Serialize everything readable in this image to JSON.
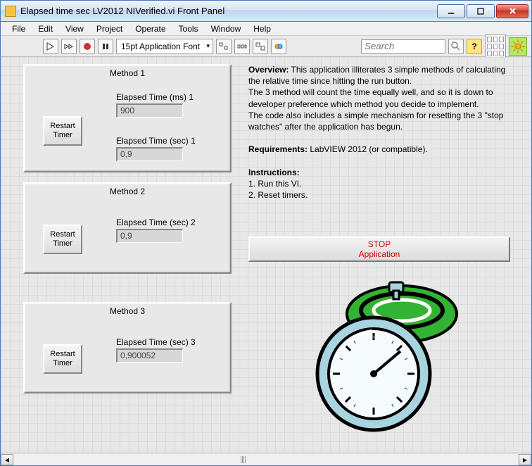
{
  "window": {
    "title": "Elapsed time sec LV2012 NIVerified.vi Front Panel"
  },
  "menu": {
    "file": "File",
    "edit": "Edit",
    "view": "View",
    "project": "Project",
    "operate": "Operate",
    "tools": "Tools",
    "window": "Window",
    "help": "Help"
  },
  "toolbar": {
    "font": "15pt Application Font",
    "search_placeholder": "Search",
    "help_label": "?"
  },
  "panels": {
    "p1": {
      "title": "Method 1",
      "restart": "Restart\nTimer",
      "label_ms": "Elapsed Time (ms) 1",
      "value_ms": "900",
      "label_sec": "Elapsed Time (sec) 1",
      "value_sec": "0,9"
    },
    "p2": {
      "title": "Method 2",
      "restart": "Restart\nTimer",
      "label": "Elapsed Time (sec) 2",
      "value": "0,9"
    },
    "p3": {
      "title": "Method 3",
      "restart": "Restart\nTimer",
      "label": "Elapsed Time (sec) 3",
      "value": "0,900052"
    }
  },
  "desc": {
    "overview_label": "Overview:",
    "overview_text": " This application illiterates 3 simple methods of calculating the relative time since hitting the run button.",
    "overview_text2": "The 3 method will count the time equally well, and so it is down to developer preference which method you decide to implement.",
    "overview_text3": "The code also includes a simple mechanism for resetting the 3 \"stop watches\" after the application has begun.",
    "req_label": "Requirements:",
    "req_text": " LabVIEW 2012 (or compatible).",
    "instr_label": "Instructions:",
    "instr1": "1. Run this VI.",
    "instr2": "2. Reset timers."
  },
  "stop": {
    "line1": "STOP",
    "line2": "Application"
  }
}
